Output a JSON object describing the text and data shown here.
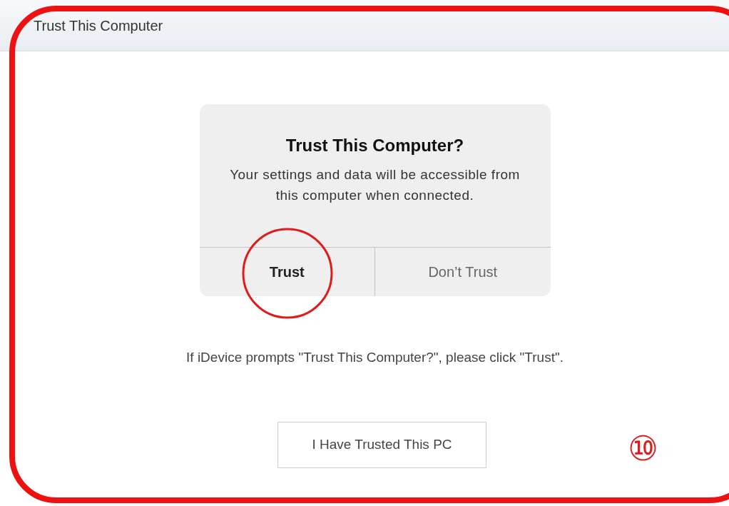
{
  "window": {
    "title": "Trust This Computer"
  },
  "dialog": {
    "title": "Trust This Computer?",
    "message": "Your settings and data will be accessible from this computer when connected.",
    "buttons": [
      {
        "label": "Trust",
        "bold": true
      },
      {
        "label": "Don’t Trust",
        "bold": false
      }
    ]
  },
  "instruction": "If iDevice prompts \"Trust This Computer?\", please click \"Trust\".",
  "confirm_button": "I Have Trusted This PC",
  "annotation": {
    "step": "⑩"
  }
}
